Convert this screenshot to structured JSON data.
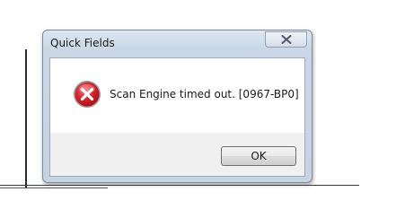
{
  "window": {
    "title": "Quick Fields"
  },
  "dialog": {
    "message": "Scan Engine timed out. [0967-BP0]",
    "icon": "error-icon",
    "ok_label": "OK"
  },
  "colors": {
    "frame": "#c9d7e6",
    "error_red": "#c4151c",
    "client_bg": "#f0f0f0"
  }
}
